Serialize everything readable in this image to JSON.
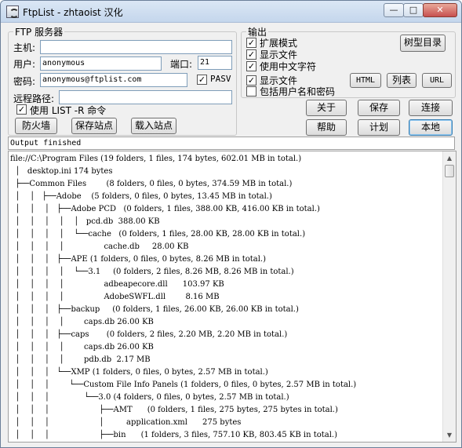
{
  "window": {
    "title": "FtpList - zhtaoist 汉化",
    "min_glyph": "—",
    "max_glyph": "□",
    "close_glyph": "✕"
  },
  "ftp_group": {
    "legend": "FTP 服务器",
    "host_label": "主机:",
    "host_value": "",
    "user_label": "用户:",
    "user_value": "anonymous",
    "port_label": "端口:",
    "port_value": "21",
    "password_label": "密码:",
    "password_value": "anonymous@ftplist.com",
    "pasv_label": "PASV",
    "pasv_checked": true,
    "remote_path_label": "远程路径:",
    "remote_path_value": "",
    "use_list_r_label": "使用 LIST -R 命令",
    "use_list_r_checked": true,
    "firewall_button": "防火墙",
    "save_site_button": "保存站点",
    "load_site_button": "载入站点"
  },
  "output_group": {
    "legend": "输出",
    "expand_mode_label": "扩展模式",
    "show_files_label": "显示文件",
    "use_chinese_label": "使用中文字符",
    "show_files2_label": "显示文件",
    "include_credentials_label": "包括用户名和密码",
    "tree_dir_button": "树型目录",
    "html_button": "HTML",
    "list_button": "列表",
    "url_button": "URL"
  },
  "actions": {
    "about": "关于",
    "save": "保存",
    "connect": "连接",
    "help": "帮助",
    "schedule": "计划",
    "local": "本地"
  },
  "status_text": "Output finished",
  "output_lines": [
    "file://C:\\Program Files (19 folders, 1 files, 174 bytes, 602.01 MB in total.)",
    "  │   desktop.ini 174 bytes",
    "  ├──Common Files        (8 folders, 0 files, 0 bytes, 374.59 MB in total.)",
    "  │    │   ├──Adobe    (5 folders, 0 files, 0 bytes, 13.45 MB in total.)",
    "  │    │    │   ├──Adobe PCD   (0 folders, 1 files, 388.00 KB, 416.00 KB in total.)",
    "  │    │    │    │    │   pcd.db  388.00 KB",
    "  │    │    │    │    └──cache   (0 folders, 1 files, 28.00 KB, 28.00 KB in total.)",
    "  │    │    │    │                cache.db     28.00 KB",
    "  │    │    │   ├──APE (1 folders, 0 files, 0 bytes, 8.26 MB in total.)",
    "  │    │    │    │    └──3.1     (0 folders, 2 files, 8.26 MB, 8.26 MB in total.)",
    "  │    │    │    │                adbeapecore.dll      103.97 KB",
    "  │    │    │    │                AdobeSWFL.dll        8.16 MB",
    "  │    │    │   ├──backup     (0 folders, 1 files, 26.00 KB, 26.00 KB in total.)",
    "  │    │    │    │        caps.db 26.00 KB",
    "  │    │    │   ├──caps       (0 folders, 2 files, 2.20 MB, 2.20 MB in total.)",
    "  │    │    │    │        caps.db 26.00 KB",
    "  │    │    │    │        pdb.db  2.17 MB",
    "  │    │    │   └──XMP (1 folders, 0 files, 0 bytes, 2.57 MB in total.)",
    "  │    │    │        └──Custom File Info Panels (1 folders, 0 files, 0 bytes, 2.57 MB in total.)",
    "  │    │    │              └──3.0 (4 folders, 0 files, 0 bytes, 2.57 MB in total.)",
    "  │    │    │                    ├──AMT      (0 folders, 1 files, 275 bytes, 275 bytes in total.)",
    "  │    │    │                    │         application.xml      275 bytes",
    "  │    │    │                    ├──bin      (1 folders, 3 files, 757.10 KB, 803.45 KB in total.)"
  ]
}
